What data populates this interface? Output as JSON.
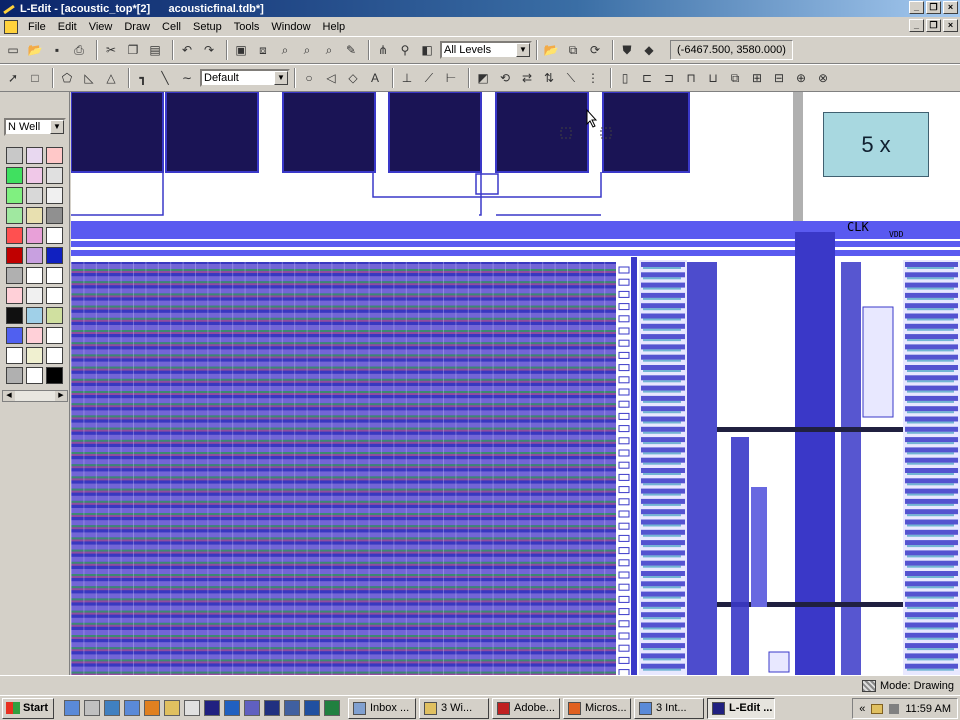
{
  "window": {
    "title": "L-Edit - [acoustic_top*[2]      acousticfinal.tdb*]",
    "minimize": "_",
    "restore": "❐",
    "close": "×"
  },
  "menu": {
    "items": [
      "File",
      "Edit",
      "View",
      "Draw",
      "Cell",
      "Setup",
      "Tools",
      "Window",
      "Help"
    ]
  },
  "toolbar": {
    "level_select": "All Levels",
    "coordinates": "(-6467.500, 3580.000)",
    "style_select": "Default"
  },
  "palette": {
    "layer_select": "N Well",
    "swatches": [
      "#c8c8c8",
      "#e8d8f0",
      "#ffc8c8",
      "#40e060",
      "#f0c8e8",
      "#e0e0e0",
      "#80f080",
      "#d8d8d8",
      "#f0f0f0",
      "#a0e8a0",
      "#e8e0b0",
      "#909090",
      "#ff5050",
      "#e8a0d8",
      "#ffffff",
      "#c00000",
      "#c8a0e0",
      "#1020c0",
      "#b0b0b0",
      "#ffffff",
      "#ffffff",
      "#ffd0d8",
      "#f0f0f0",
      "#ffffff",
      "#101010",
      "#a0d0e8",
      "#d0e0a0",
      "#5060f0",
      "#ffd0d8",
      "#ffffff",
      "#ffffff",
      "#f0f0d0",
      "#ffffff",
      "#b0b0b0",
      "#ffffff",
      "#000000"
    ]
  },
  "canvas": {
    "annotation_box": "5 x",
    "label_clk": "CLK",
    "label_vdd": "VDD"
  },
  "status": {
    "mode": "Mode: Drawing"
  },
  "taskbar": {
    "start": "Start",
    "tasks": [
      "Inbox ...",
      "3 Wi...",
      "Adobe...",
      "Micros...",
      "3 Int...",
      "L-Edit ..."
    ],
    "clock": "11:59 AM"
  }
}
